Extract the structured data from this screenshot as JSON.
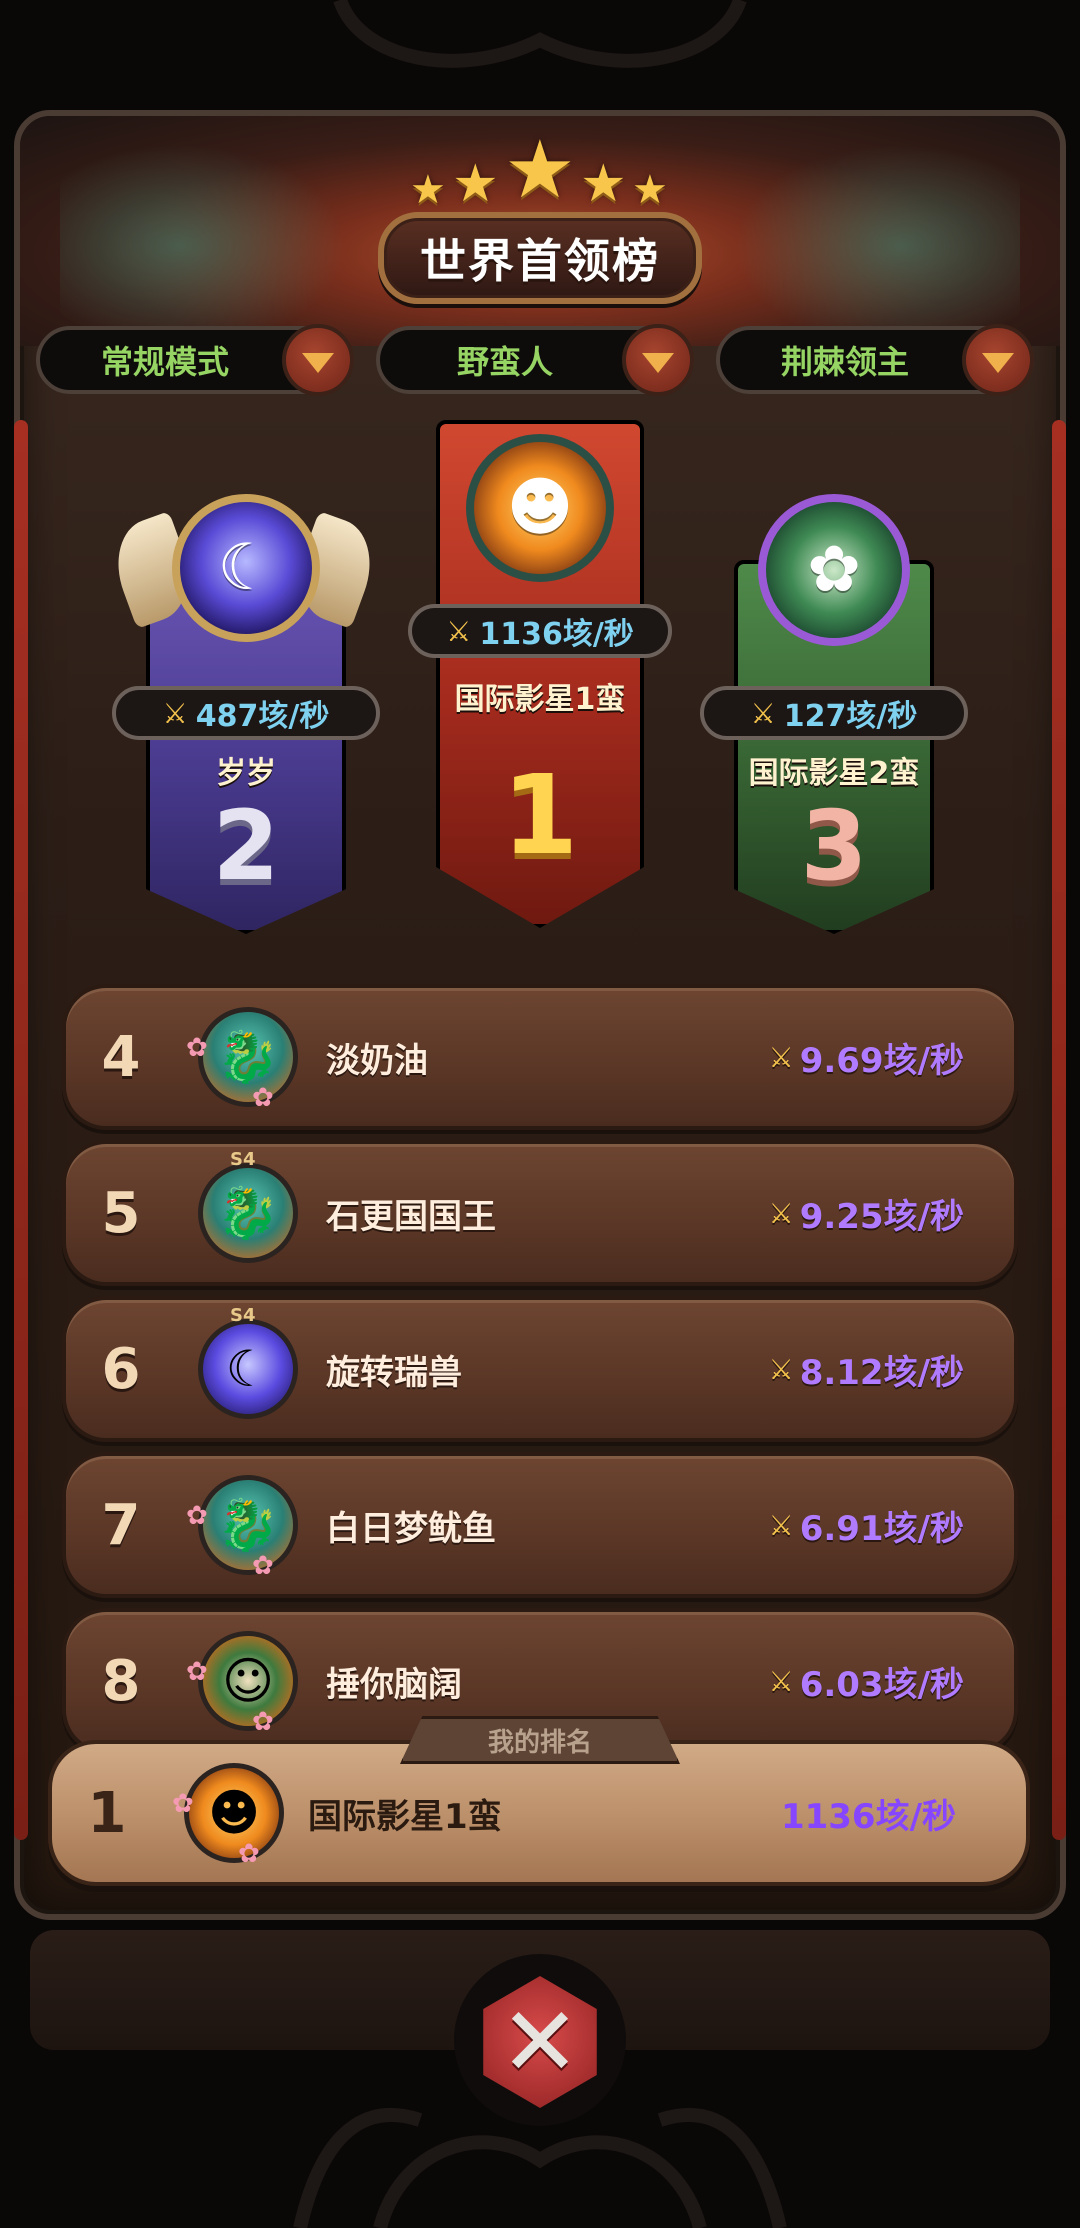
{
  "title": "世界首领榜",
  "filters": [
    {
      "label": "常规模式"
    },
    {
      "label": "野蛮人"
    },
    {
      "label": "荆棘领主"
    }
  ],
  "podium": {
    "first": {
      "rank": "1",
      "name": "国际影星1蛮",
      "score": "1136垓/秒"
    },
    "second": {
      "rank": "2",
      "name": "岁岁",
      "score": "487垓/秒"
    },
    "third": {
      "rank": "3",
      "name": "国际影星2蛮",
      "score": "127垓/秒"
    }
  },
  "rows": [
    {
      "rank": "4",
      "name": "淡奶油",
      "score": "9.69垓/秒"
    },
    {
      "rank": "5",
      "name": "石更国国王",
      "score": "9.25垓/秒",
      "badge": "S4"
    },
    {
      "rank": "6",
      "name": "旋转瑞兽",
      "score": "8.12垓/秒",
      "badge": "S4"
    },
    {
      "rank": "7",
      "name": "白日梦鱿鱼",
      "score": "6.91垓/秒"
    },
    {
      "rank": "8",
      "name": "捶你脑阔",
      "score": "6.03垓/秒"
    }
  ],
  "my_rank": {
    "tab_label": "我的排名",
    "rank": "1",
    "name": "国际影星1蛮",
    "score": "1136垓/秒"
  },
  "icons": {
    "sword": "crossed-swords-icon",
    "close": "close-icon",
    "dropdown": "chevron-down-icon"
  },
  "colors": {
    "score_blue": "#7fd1f0",
    "score_purple": "#b07bff",
    "filter_green": "#96d563",
    "gold": "#ffd450"
  }
}
